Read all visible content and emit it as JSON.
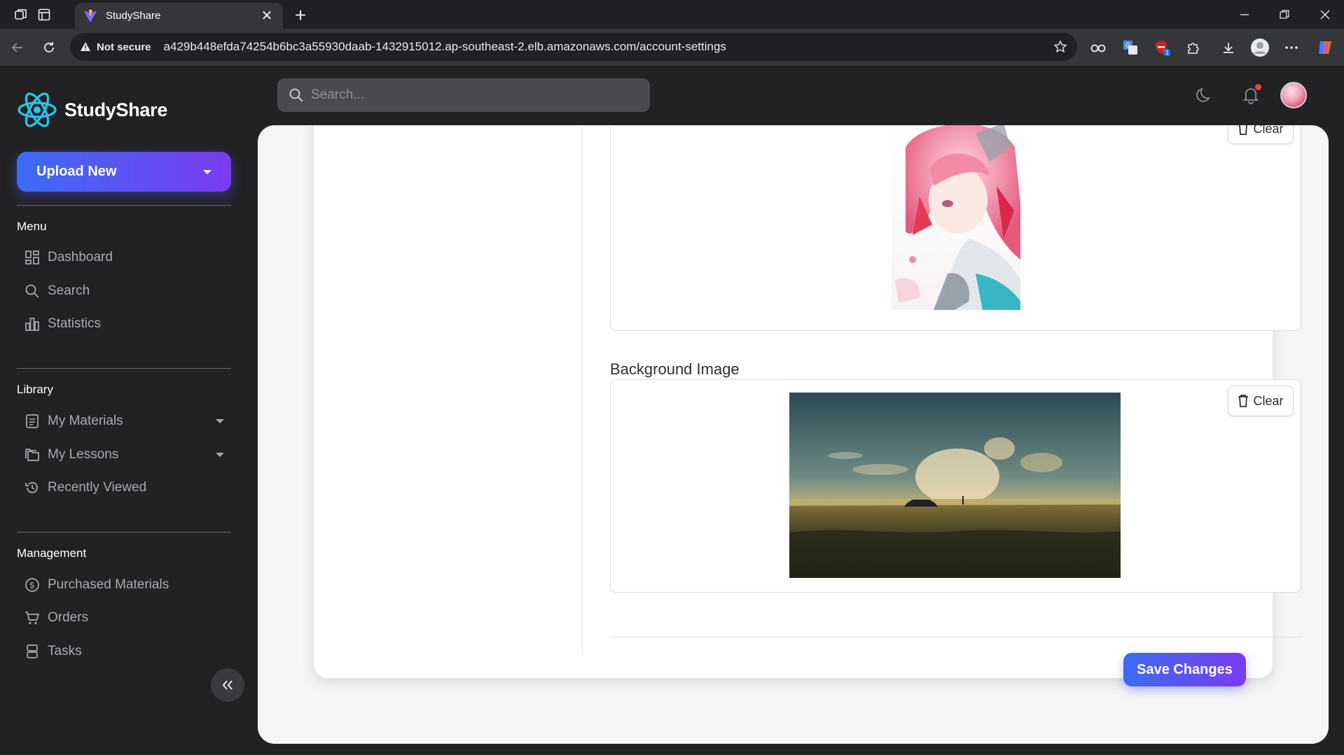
{
  "browser": {
    "tab_title": "StudyShare",
    "security_label": "Not secure",
    "url": "a429b448efda74254b6bc3a55930daab-1432915012.ap-southeast-2.elb.amazonaws.com/account-settings",
    "extension_badge": "1"
  },
  "app": {
    "brand": "StudyShare",
    "upload_button": "Upload New",
    "search": {
      "placeholder": "Search..."
    },
    "sections": {
      "menu": "Menu",
      "library": "Library",
      "management": "Management"
    },
    "menu_items": [
      "Dashboard",
      "Search",
      "Statistics"
    ],
    "library_items": [
      "My Materials",
      "My Lessons",
      "Recently Viewed"
    ],
    "management_items": [
      "Purchased Materials",
      "Orders",
      "Tasks"
    ]
  },
  "settings": {
    "avatar_clear": "Clear",
    "background_label": "Background Image",
    "background_clear": "Clear",
    "save_button": "Save Changes"
  },
  "colors": {
    "accent_start": "#3b6bf5",
    "accent_end": "#7a3cf0",
    "sidebar_bg": "#222225",
    "notification_dot": "#ff3b3b"
  }
}
